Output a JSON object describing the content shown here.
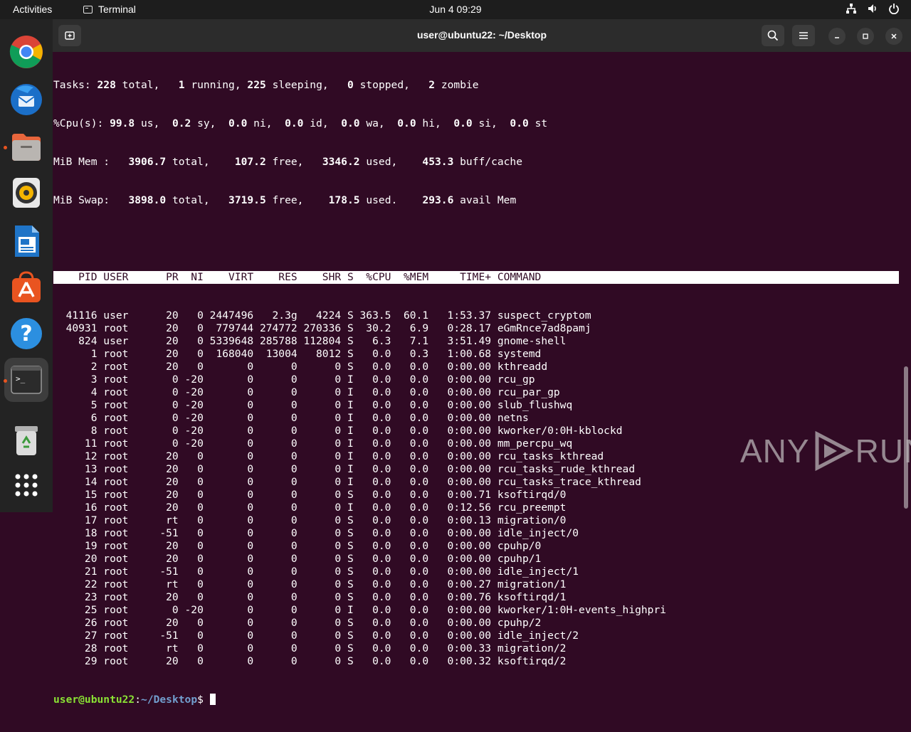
{
  "topbar": {
    "activities": "Activities",
    "app_name": "Terminal",
    "clock": "Jun 4  09:29",
    "tray_icons": [
      "network-icon",
      "volume-icon",
      "power-icon"
    ]
  },
  "dock": {
    "items": [
      {
        "name": "chrome",
        "active": false
      },
      {
        "name": "thunderbird",
        "active": false
      },
      {
        "name": "files",
        "active": false,
        "running": true
      },
      {
        "name": "rhythmbox",
        "active": false
      },
      {
        "name": "libreoffice-writer",
        "active": false
      },
      {
        "name": "app-center",
        "active": false
      },
      {
        "name": "help",
        "active": false
      },
      {
        "name": "terminal",
        "active": true,
        "running": true
      },
      {
        "name": "trash",
        "active": false
      },
      {
        "name": "show-apps",
        "active": false
      }
    ]
  },
  "window": {
    "title": "user@ubuntu22: ~/Desktop"
  },
  "top": {
    "summary": [
      "Tasks: 228 total,   1 running, 225 sleeping,   0 stopped,   2 zombie",
      "%Cpu(s): 99.8 us,  0.2 sy,  0.0 ni,  0.0 id,  0.0 wa,  0.0 hi,  0.0 si,  0.0 st",
      "MiB Mem :   3906.7 total,    107.2 free,   3346.2 used,    453.3 buff/cache",
      "MiB Swap:   3898.0 total,   3719.5 free,    178.5 used.    293.6 avail Mem"
    ],
    "header": "    PID USER      PR  NI    VIRT    RES    SHR S  %CPU  %MEM     TIME+ COMMAND",
    "rows": [
      "  41116 user      20   0 2447496   2.3g   4224 S 363.5  60.1   1:53.37 suspect_cryptom",
      "  40931 root      20   0  779744 274772 270336 S  30.2   6.9   0:28.17 eGmRnce7ad8pamj",
      "    824 user      20   0 5339648 285788 112804 S   6.3   7.1   3:51.49 gnome-shell",
      "      1 root      20   0  168040  13004   8012 S   0.0   0.3   1:00.68 systemd",
      "      2 root      20   0       0      0      0 S   0.0   0.0   0:00.00 kthreadd",
      "      3 root       0 -20       0      0      0 I   0.0   0.0   0:00.00 rcu_gp",
      "      4 root       0 -20       0      0      0 I   0.0   0.0   0:00.00 rcu_par_gp",
      "      5 root       0 -20       0      0      0 I   0.0   0.0   0:00.00 slub_flushwq",
      "      6 root       0 -20       0      0      0 I   0.0   0.0   0:00.00 netns",
      "      8 root       0 -20       0      0      0 I   0.0   0.0   0:00.00 kworker/0:0H-kblockd",
      "     11 root       0 -20       0      0      0 I   0.0   0.0   0:00.00 mm_percpu_wq",
      "     12 root      20   0       0      0      0 I   0.0   0.0   0:00.00 rcu_tasks_kthread",
      "     13 root      20   0       0      0      0 I   0.0   0.0   0:00.00 rcu_tasks_rude_kthread",
      "     14 root      20   0       0      0      0 I   0.0   0.0   0:00.00 rcu_tasks_trace_kthread",
      "     15 root      20   0       0      0      0 S   0.0   0.0   0:00.71 ksoftirqd/0",
      "     16 root      20   0       0      0      0 I   0.0   0.0   0:12.56 rcu_preempt",
      "     17 root      rt   0       0      0      0 S   0.0   0.0   0:00.13 migration/0",
      "     18 root     -51   0       0      0      0 S   0.0   0.0   0:00.00 idle_inject/0",
      "     19 root      20   0       0      0      0 S   0.0   0.0   0:00.00 cpuhp/0",
      "     20 root      20   0       0      0      0 S   0.0   0.0   0:00.00 cpuhp/1",
      "     21 root     -51   0       0      0      0 S   0.0   0.0   0:00.00 idle_inject/1",
      "     22 root      rt   0       0      0      0 S   0.0   0.0   0:00.27 migration/1",
      "     23 root      20   0       0      0      0 S   0.0   0.0   0:00.76 ksoftirqd/1",
      "     25 root       0 -20       0      0      0 I   0.0   0.0   0:00.00 kworker/1:0H-events_highpri",
      "     26 root      20   0       0      0      0 S   0.0   0.0   0:00.00 cpuhp/2",
      "     27 root     -51   0       0      0      0 S   0.0   0.0   0:00.00 idle_inject/2",
      "     28 root      rt   0       0      0      0 S   0.0   0.0   0:00.33 migration/2",
      "     29 root      20   0       0      0      0 S   0.0   0.0   0:00.32 ksoftirqd/2"
    ]
  },
  "prompt": {
    "user_host": "user@ubuntu22",
    "sep": ":",
    "path": "~/Desktop",
    "symbol": "$ "
  },
  "watermark": {
    "left": "ANY",
    "right": "RUN"
  },
  "colors": {
    "terminal_bg": "#300a24",
    "prompt_user": "#8ae234",
    "prompt_path": "#729fcf",
    "accent": "#e95420"
  }
}
